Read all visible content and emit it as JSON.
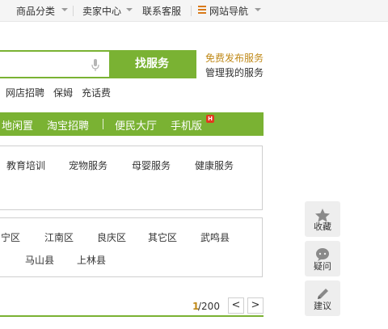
{
  "topbar": {
    "category": "商品分类",
    "seller_center": "卖家中心",
    "customer_service": "联系客服",
    "site_nav": "网站导航"
  },
  "search": {
    "value": "",
    "button_label": "找服务",
    "free_post": "免费发布服务",
    "manage": "管理我的服务"
  },
  "hotlinks": [
    "网店招聘",
    "保姆",
    "充话费"
  ],
  "nav": {
    "items": [
      "地闲置",
      "淘宝招聘",
      "便民大厅",
      "手机版"
    ],
    "badge": "H"
  },
  "categories": [
    "教育培训",
    "宠物服务",
    "母婴服务",
    "健康服务"
  ],
  "districts": {
    "row1": [
      "宁区",
      "江南区",
      "良庆区",
      "其它区",
      "武鸣县"
    ],
    "row2": [
      "马山县",
      "上林县"
    ]
  },
  "pagination": {
    "current": "1",
    "total": "/200",
    "prev": "<",
    "next": ">"
  },
  "sidebar": {
    "favorite": "收藏",
    "question": "疑问",
    "suggest": "建议"
  },
  "colors": {
    "brand_green": "#7ab233",
    "accent_orange": "#c08a19"
  }
}
